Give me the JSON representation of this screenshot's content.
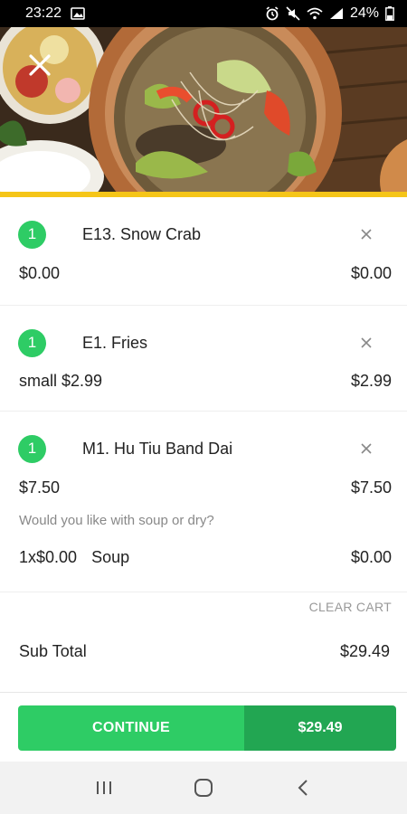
{
  "status_bar": {
    "time": "23:22",
    "battery": "24%",
    "icons": [
      "image-icon",
      "alarm-icon",
      "mute-icon",
      "wifi-icon",
      "signal-icon",
      "battery-icon"
    ]
  },
  "header": {
    "close_icon": "close-icon"
  },
  "cart": {
    "items": [
      {
        "quantity": "1",
        "name": "E13. Snow Crab",
        "price_left": "$0.00",
        "price_right": "$0.00"
      },
      {
        "quantity": "1",
        "name": "E1. Fries",
        "price_left": "small $2.99",
        "price_right": "$2.99"
      },
      {
        "quantity": "1",
        "name": "M1. Hu Tiu Band Dai",
        "price_left": "$7.50",
        "price_right": "$7.50",
        "modifier_question": "Would you like with soup or dry?",
        "option": {
          "qty_price": "1x$0.00",
          "label": "Soup",
          "price": "$0.00"
        }
      }
    ],
    "clear_label": "CLEAR CART",
    "subtotal_label": "Sub Total",
    "subtotal_value": "$29.49"
  },
  "checkout": {
    "continue_label": "CONTINUE",
    "total": "$29.49"
  },
  "colors": {
    "accent_green": "#2ECC65",
    "dark_green": "#22A652",
    "accent_yellow": "#F5C518"
  },
  "nav": {
    "icons": [
      "recent-apps-icon",
      "home-icon",
      "back-icon"
    ]
  }
}
